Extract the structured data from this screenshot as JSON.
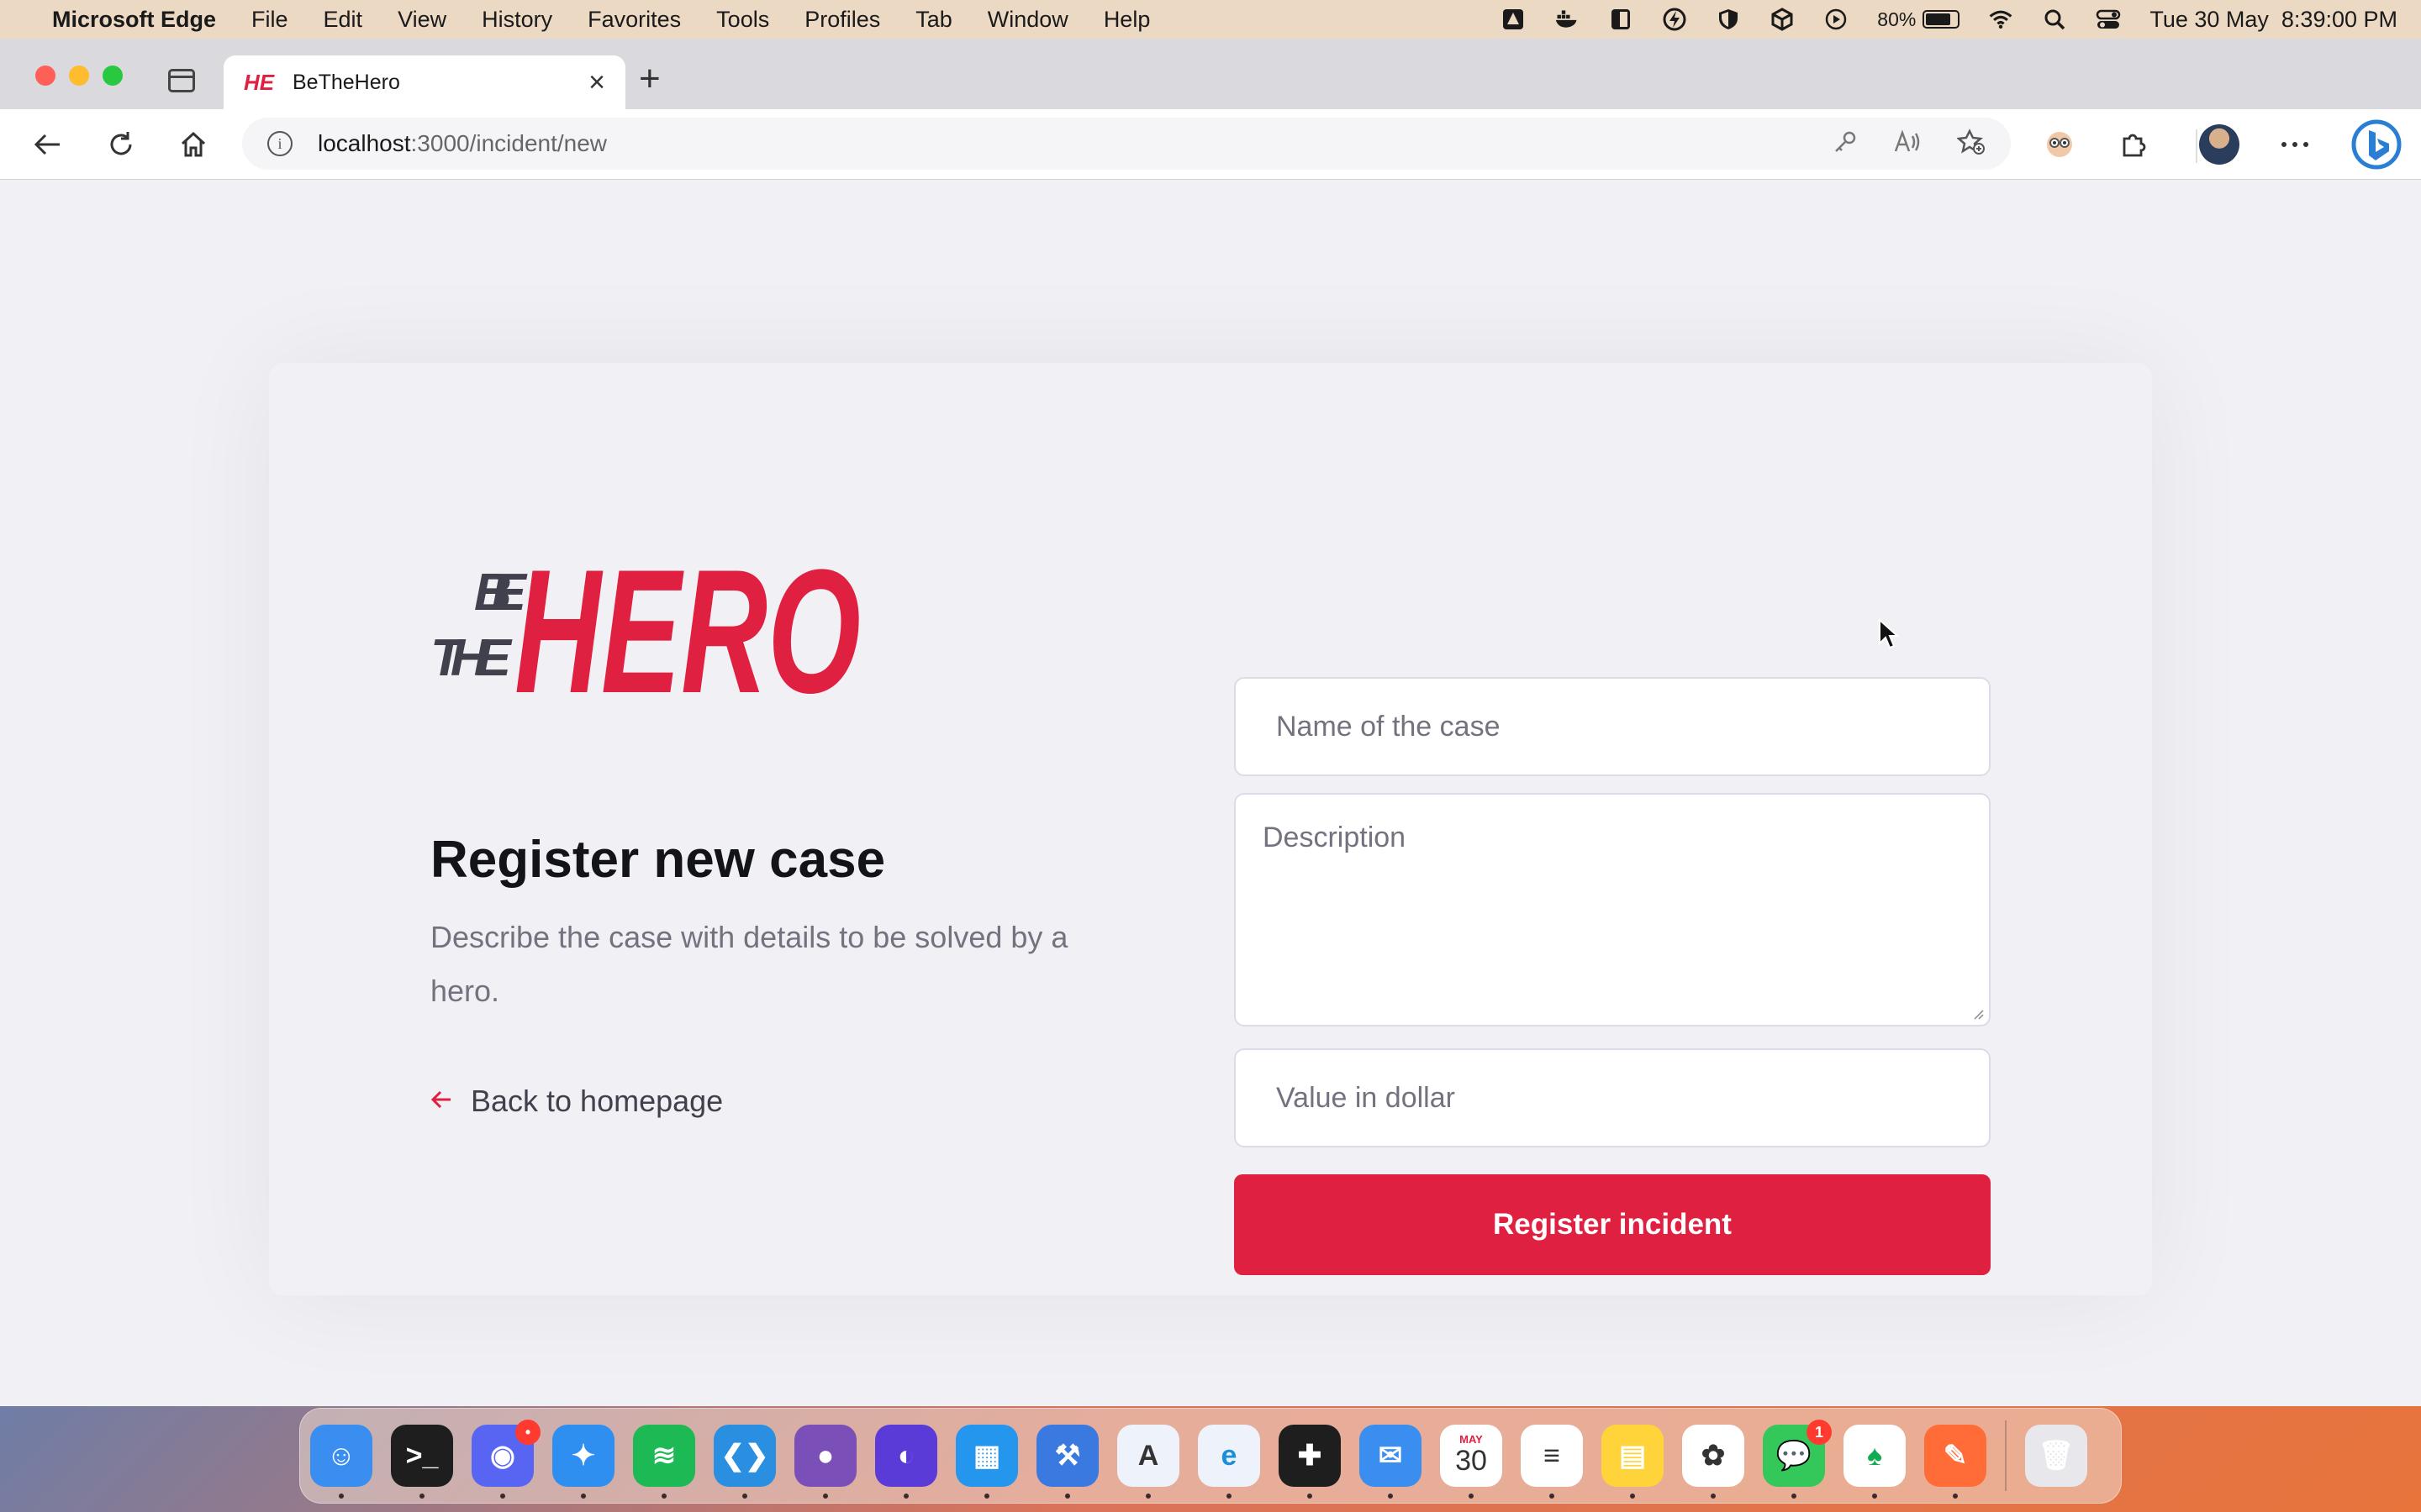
{
  "menubar": {
    "app_name": "Microsoft Edge",
    "menus": [
      "File",
      "Edit",
      "View",
      "History",
      "Favorites",
      "Tools",
      "Profiles",
      "Tab",
      "Window",
      "Help"
    ],
    "battery_percent": "80%",
    "battery_level": 0.8,
    "datetime": "Tue 30 May  8:39:00 PM"
  },
  "browser": {
    "tab_title": "BeTheHero",
    "tab_favicon": "HE",
    "url_host": "localhost",
    "url_path": ":3000/incident/new"
  },
  "page": {
    "logo": {
      "line1": "BE",
      "line2": "THE",
      "word": "HERO"
    },
    "heading": "Register new case",
    "description": "Describe the case with details to be solved by a hero.",
    "back_label": "Back to homepage",
    "name_placeholder": "Name of the case",
    "description_placeholder": "Description",
    "value_placeholder": "Value in dollar",
    "submit_label": "Register incident",
    "accent_color": "#e02041"
  },
  "dock": {
    "apps": [
      {
        "name": "Finder",
        "color": "#3a8ef0",
        "glyph": "☺"
      },
      {
        "name": "Terminal",
        "color": "#1e1e1e",
        "glyph": ">_"
      },
      {
        "name": "Discord",
        "color": "#5865f2",
        "glyph": "◉",
        "badge": "•"
      },
      {
        "name": "Safari",
        "color": "#2f8ff0",
        "glyph": "✦"
      },
      {
        "name": "Spotify",
        "color": "#1db954",
        "glyph": "≋"
      },
      {
        "name": "VS Code",
        "color": "#2a8fe0",
        "glyph": "❮❯"
      },
      {
        "name": "GitHub Desktop",
        "color": "#7b4fb8",
        "glyph": "●"
      },
      {
        "name": "Arc",
        "color": "#5a3bd8",
        "glyph": "◐"
      },
      {
        "name": "Docker",
        "color": "#2496ed",
        "glyph": "▦"
      },
      {
        "name": "Xcode",
        "color": "#3a7ae0",
        "glyph": "⚒"
      },
      {
        "name": "App Store",
        "color": "#eef3fb",
        "glyph": "A"
      },
      {
        "name": "Edge",
        "color": "#eef3fb",
        "glyph": "e"
      },
      {
        "name": "Figma",
        "color": "#1e1e1e",
        "glyph": "✚"
      },
      {
        "name": "Mail",
        "color": "#3a8ef0",
        "glyph": "✉"
      },
      {
        "name": "Calendar",
        "color": "#ffffff",
        "glyph": "30",
        "sub": "MAY"
      },
      {
        "name": "Reminders",
        "color": "#ffffff",
        "glyph": "≡"
      },
      {
        "name": "Notes",
        "color": "#ffd43b",
        "glyph": "▤"
      },
      {
        "name": "Photos",
        "color": "#ffffff",
        "glyph": "✿"
      },
      {
        "name": "Messages",
        "color": "#34c759",
        "glyph": "💬",
        "badge": "1"
      },
      {
        "name": "MongoDB Compass",
        "color": "#ffffff",
        "glyph": "♠"
      },
      {
        "name": "Postman",
        "color": "#ff6c37",
        "glyph": "✎"
      }
    ],
    "trash": {
      "name": "Trash",
      "color": "#e8e8ec",
      "glyph": "🗑"
    }
  }
}
